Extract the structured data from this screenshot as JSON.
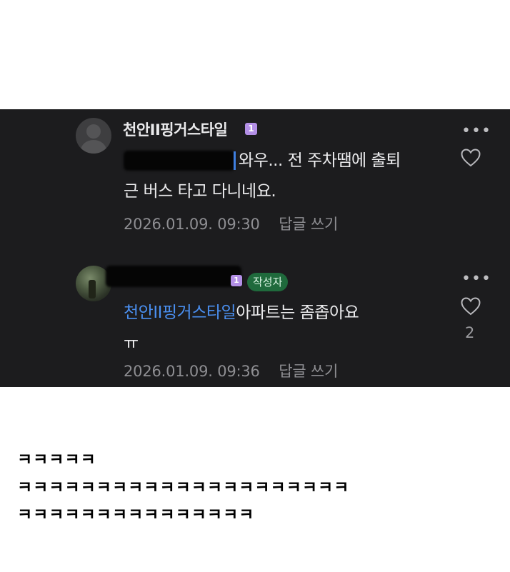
{
  "comments": [
    {
      "author": "천안II핑거스타일",
      "level": "1",
      "body_line1": "와우... 전 주차땜에 출퇴",
      "body_line2": "근 버스 타고 다니네요.",
      "timestamp": "2026.01.09. 09:30",
      "reply_label": "답글 쓰기",
      "more_label": "•••",
      "colors": {
        "level_badge": "#b38fe6",
        "background": "#1c1c1e"
      }
    },
    {
      "author_tag": "작성자",
      "level": "1",
      "mention": "천안II핑거스타일",
      "body_line1": "아파트는  좀좁아요",
      "body_line2": "ㅠ",
      "timestamp": "2026.01.09. 09:36",
      "reply_label": "답글 쓰기",
      "more_label": "•••",
      "like_count": "2",
      "colors": {
        "author_tag_bg": "#1f6a3c",
        "mention": "#4a8ff0"
      }
    }
  ],
  "caption_lines": [
    "ㅋㅋㅋㅋㅋ",
    "ㅋㅋㅋㅋㅋㅋㅋㅋㅋㅋㅋㅋㅋㅋㅋㅋㅋㅋㅋㅋㅋ",
    "ㅋㅋㅋㅋㅋㅋㅋㅋㅋㅋㅋㅋㅋㅋㅋ"
  ],
  "icons": [
    "avatar-placeholder-icon",
    "heart-icon",
    "more-icon"
  ]
}
